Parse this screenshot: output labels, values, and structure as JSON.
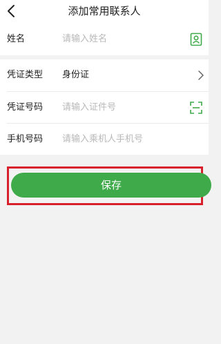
{
  "header": {
    "title": "添加常用联系人",
    "back_icon": "back-chevron-icon"
  },
  "form": {
    "name": {
      "label": "姓名",
      "placeholder": "请输入姓名",
      "icon": "contact-card-icon"
    },
    "id_type": {
      "label": "凭证类型",
      "value": "身份证",
      "icon": "chevron-right-icon"
    },
    "id_number": {
      "label": "凭证号码",
      "placeholder": "请输入证件号",
      "icon": "scan-icon"
    },
    "phone": {
      "label": "手机号码",
      "placeholder": "请输入乘机人手机号"
    }
  },
  "actions": {
    "save_label": "保存"
  },
  "colors": {
    "accent_green": "#3faa4a",
    "highlight_red": "#d8202c"
  }
}
